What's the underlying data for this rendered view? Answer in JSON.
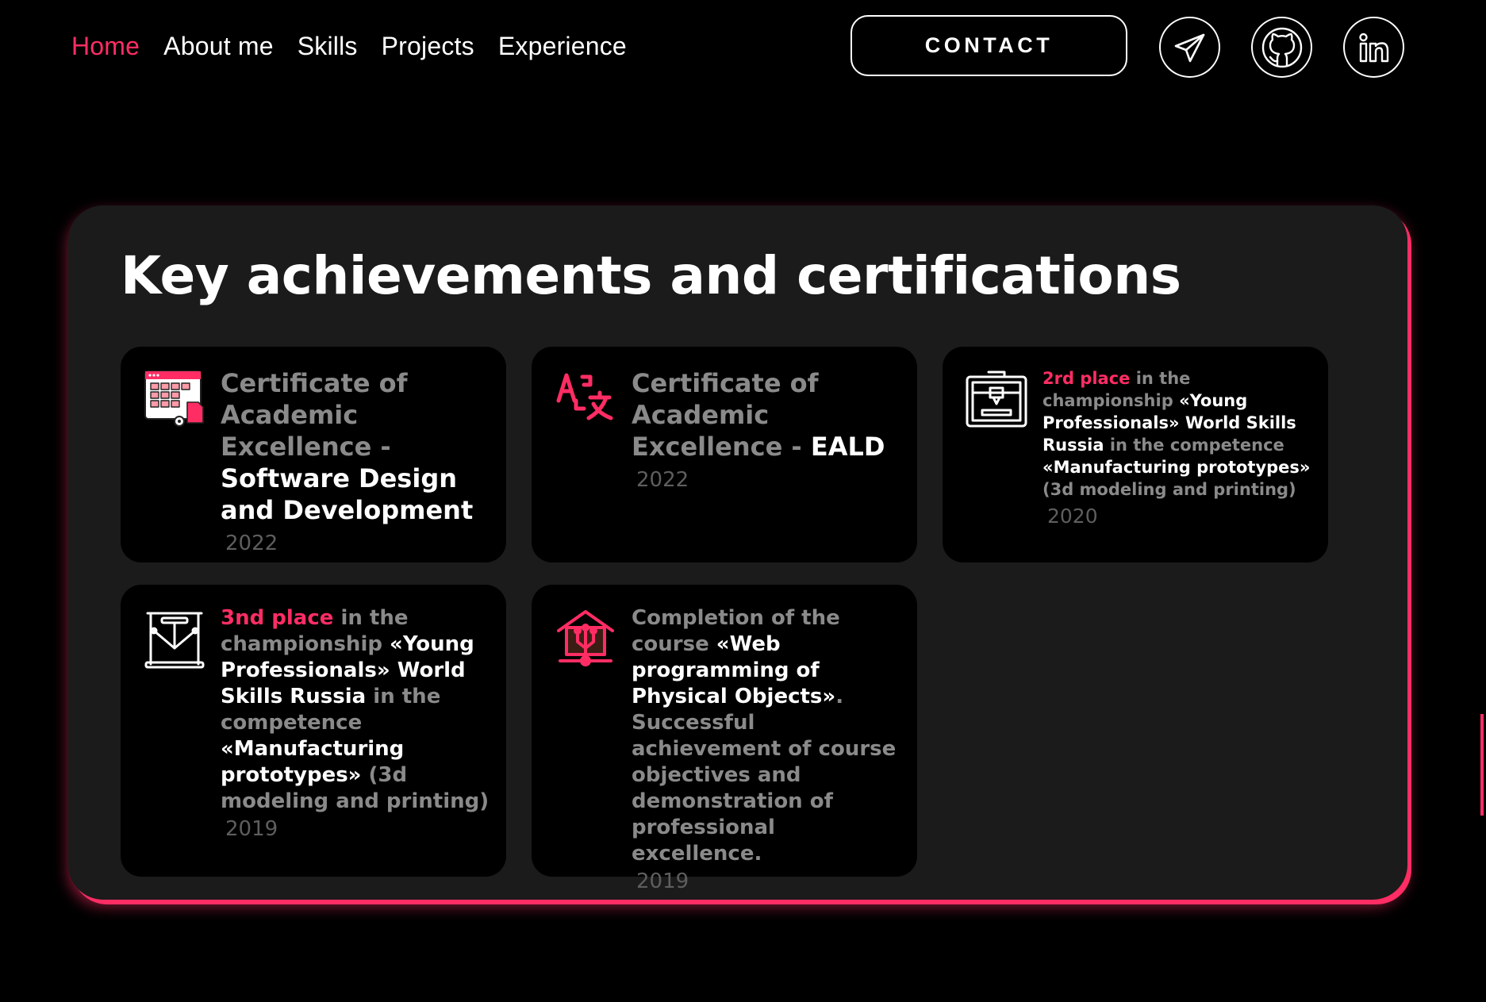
{
  "nav": {
    "items": [
      {
        "label": "Home",
        "active": true
      },
      {
        "label": "About me",
        "active": false
      },
      {
        "label": "Skills",
        "active": false
      },
      {
        "label": "Projects",
        "active": false
      },
      {
        "label": "Experience",
        "active": false
      }
    ]
  },
  "header": {
    "contact_label": "CONTACT",
    "social_icons": [
      "telegram-icon",
      "github-icon",
      "linkedin-icon"
    ]
  },
  "colors": {
    "accent": "#ff2d64",
    "background": "#000000",
    "panel": "#1b1b1b",
    "muted_text": "#8a8a8a"
  },
  "achievements": {
    "title": "Key achievements and certifications",
    "items": [
      {
        "icon": "software-design-icon",
        "muted_text": "Certificate of Academic Excellence -",
        "highlight_text": "Software Design and Development",
        "year": "2022"
      },
      {
        "icon": "translate-icon",
        "muted_text": "Certificate of Academic Excellence -",
        "highlight_text": "EALD",
        "year": "2022"
      },
      {
        "icon": "3d-printer-icon",
        "accent_text": "2rd place",
        "text_1": "in the championship",
        "highlight_1": "«Young Professionals» World Skills Russia",
        "text_2": "in the competence",
        "highlight_2": "«Manufacturing prototypes»",
        "text_3": "(3d modeling and printing)",
        "year": "2020"
      },
      {
        "icon": "3d-model-icon",
        "accent_text": "3nd place",
        "text_1": "in the championship",
        "highlight_1": "«Young Professionals» World Skills Russia",
        "text_2": "in the competence",
        "highlight_2": "«Manufacturing prototypes»",
        "text_3": "(3d modeling and printing)",
        "year": "2019"
      },
      {
        "icon": "smart-home-icon",
        "text_1": "Completion of the course",
        "highlight_1": "«Web programming of Physical Objects»",
        "text_2": ". Successful achievement of course objectives and demonstration of professional excellence.",
        "year": "2019"
      }
    ]
  }
}
